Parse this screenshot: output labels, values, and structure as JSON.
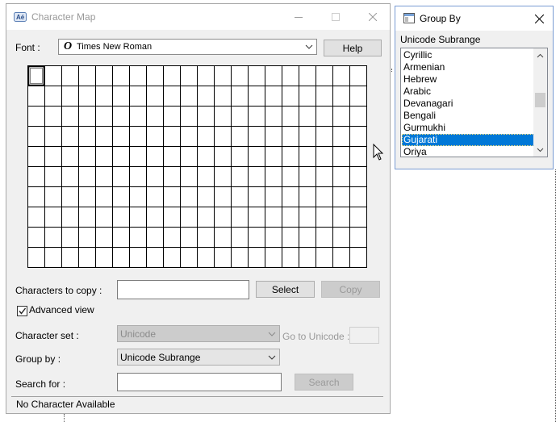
{
  "charmap": {
    "title": "Character Map",
    "font_label": "Font :",
    "font_icon": "opentype-font-icon",
    "font_glyph": "O",
    "font_value": "Times New Roman",
    "help_label": "Help",
    "grid": {
      "cols": 20,
      "rows": 10,
      "selected_index": 0
    },
    "chars_to_copy_label": "Characters to copy :",
    "chars_to_copy_value": "",
    "select_label": "Select",
    "copy_label": "Copy",
    "advanced_view_label": "Advanced view",
    "advanced_view_checked": true,
    "character_set_label": "Character set :",
    "character_set_value": "Unicode",
    "go_to_unicode_label": "Go to Unicode :",
    "go_to_unicode_value": "",
    "group_by_label": "Group by :",
    "group_by_value": "Unicode Subrange",
    "search_for_label": "Search for :",
    "search_value": "",
    "search_label": "Search",
    "status_text": "No Character Available"
  },
  "group_by": {
    "title": "Group By",
    "list_label": "Unicode Subrange",
    "items": [
      {
        "label": "Cyrillic",
        "selected": false
      },
      {
        "label": "Armenian",
        "selected": false
      },
      {
        "label": "Hebrew",
        "selected": false
      },
      {
        "label": "Arabic",
        "selected": false
      },
      {
        "label": "Devanagari",
        "selected": false
      },
      {
        "label": "Bengali",
        "selected": false
      },
      {
        "label": "Gurmukhi",
        "selected": false
      },
      {
        "label": "Gujarati",
        "selected": true
      },
      {
        "label": "Oriya",
        "selected": false
      }
    ]
  },
  "colors": {
    "selection": "#0078d7",
    "window_bg": "#f0f0f0",
    "disabled_button": "#cccccc"
  }
}
